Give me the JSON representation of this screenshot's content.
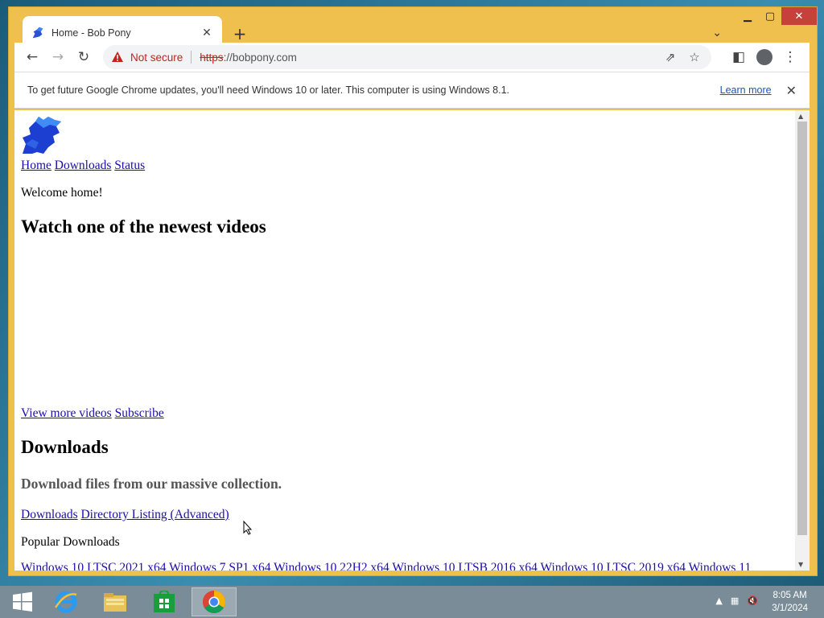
{
  "browser": {
    "tab_title": "Home - Bob Pony",
    "tab_close": "✕",
    "new_tab": "+",
    "security_label": "Not secure",
    "url_scheme": "https",
    "url_rest": "://bobpony.com",
    "infobar_text": "To get future Google Chrome updates, you'll need Windows 10 or later. This computer is using Windows 8.1.",
    "infobar_link": "Learn more",
    "infobar_close": "✕"
  },
  "page": {
    "nav": [
      "Home",
      "Downloads",
      "Status"
    ],
    "welcome": "Welcome home!",
    "videos_heading": "Watch one of the newest videos",
    "video_links": [
      "View more videos",
      "Subscribe"
    ],
    "downloads_heading": "Downloads",
    "downloads_sub": "Download files from our massive collection.",
    "download_links": [
      "Downloads",
      "Directory Listing (Advanced)"
    ],
    "popular_label": "Popular Downloads",
    "popular_items": [
      "Windows 10 LTSC 2021 x64",
      "Windows 7 SP1 x64",
      "Windows 10 22H2 x64",
      "Windows 10 LTSB 2016 x64",
      "Windows 10 LTSC 2019 x64",
      "Windows 11"
    ]
  },
  "taskbar": {
    "time": "8:05 AM",
    "date": "3/1/2024"
  },
  "colors": {
    "window_frame": "#f0c04e",
    "link": "#1a0dab",
    "not_secure": "#c5221f",
    "close_button": "#c7413b"
  }
}
